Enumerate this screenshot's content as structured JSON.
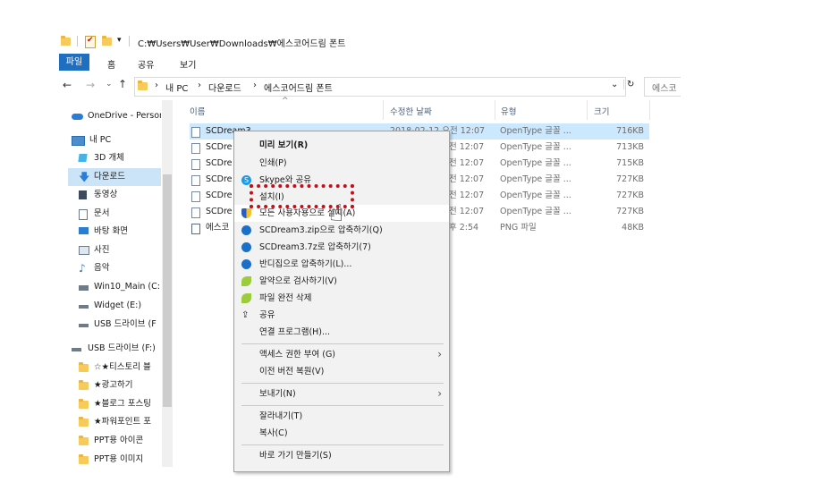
{
  "titlebar": {
    "path": "C:₩Users₩User₩Downloads₩에스코어드림 폰트"
  },
  "ribbon": {
    "tabs": [
      "파일",
      "홈",
      "공유",
      "보기"
    ]
  },
  "address": {
    "crumbs": [
      "내 PC",
      "다운로드",
      "에스코어드림 폰트"
    ],
    "search_placeholder": "에스코"
  },
  "nav": {
    "items": [
      {
        "label": "OneDrive - Personal",
        "icon": "cloud-icon"
      },
      {
        "label": "내 PC",
        "icon": "pc-icon"
      },
      {
        "label": "3D 개체",
        "icon": "cube-icon"
      },
      {
        "label": "다운로드",
        "icon": "download-arrow-icon"
      },
      {
        "label": "동영상",
        "icon": "video-icon"
      },
      {
        "label": "문서",
        "icon": "document-icon"
      },
      {
        "label": "바탕 화면",
        "icon": "desktop-icon"
      },
      {
        "label": "사진",
        "icon": "picture-icon"
      },
      {
        "label": "음악",
        "icon": "music-icon"
      },
      {
        "label": "Win10_Main (C:",
        "icon": "drive-icon"
      },
      {
        "label": "Widget (E:)",
        "icon": "drive-icon"
      },
      {
        "label": "USB 드라이브 (F",
        "icon": "usb-drive-icon"
      },
      {
        "label": "USB 드라이브 (F:)",
        "icon": "usb-drive-icon"
      },
      {
        "label": "☆★티스토리 블",
        "icon": "folder-icon"
      },
      {
        "label": "★광고하기",
        "icon": "folder-icon"
      },
      {
        "label": "★블로그 포스팅",
        "icon": "folder-icon"
      },
      {
        "label": "★파워포인트 포",
        "icon": "folder-icon"
      },
      {
        "label": "PPT용 아이콘",
        "icon": "folder-icon"
      },
      {
        "label": "PPT용 이미지",
        "icon": "folder-icon"
      }
    ]
  },
  "columns": {
    "name": "이름",
    "date": "수정한 날짜",
    "type": "유형",
    "size": "크기"
  },
  "files": [
    {
      "name": "SCDream3",
      "date": "2018-02-12 오전 12:07",
      "type": "OpenType 글꼴 ...",
      "size": "716KB"
    },
    {
      "name": "SCDre",
      "date": "전 12:07",
      "type": "OpenType 글꼴 ...",
      "size": "713KB"
    },
    {
      "name": "SCDre",
      "date": "전 12:07",
      "type": "OpenType 글꼴 ...",
      "size": "715KB"
    },
    {
      "name": "SCDre",
      "date": "전 12:07",
      "type": "OpenType 글꼴 ...",
      "size": "727KB"
    },
    {
      "name": "SCDre",
      "date": "전 12:07",
      "type": "OpenType 글꼴 ...",
      "size": "727KB"
    },
    {
      "name": "SCDre",
      "date": "전 12:07",
      "type": "OpenType 글꼴 ...",
      "size": "727KB"
    },
    {
      "name": "에스코",
      "date": "후 2:54",
      "type": "PNG 파일",
      "size": "48KB"
    }
  ],
  "context_menu": {
    "items": [
      {
        "label": "미리 보기(R)",
        "icon": "",
        "bold": true
      },
      {
        "label": "인쇄(P)",
        "icon": ""
      },
      {
        "label": "Skype와 공유",
        "icon": "skype-icon"
      },
      {
        "label": "설치(I)",
        "icon": ""
      },
      {
        "label": "모든 사용자용으로 설치(A)",
        "icon": "shield-icon"
      },
      {
        "label": "SCDream3.zip으로 압축하기(Q)",
        "icon": "bandizip-icon"
      },
      {
        "label": "SCDream3.7z로 압축하기(7)",
        "icon": "bandizip-icon"
      },
      {
        "label": "반디집으로 압축하기(L)...",
        "icon": "bandizip-icon"
      },
      {
        "label": "알약으로 검사하기(V)",
        "icon": "alyac-icon"
      },
      {
        "label": "파일 완전 삭제",
        "icon": "alyac-icon"
      },
      {
        "label": "공유",
        "icon": "share-icon"
      },
      {
        "label": "연결 프로그램(H)...",
        "icon": ""
      },
      {
        "label": "액세스 권한 부여 (G)",
        "icon": "",
        "submenu": true
      },
      {
        "label": "이전 버전 복원(V)",
        "icon": ""
      },
      {
        "label": "보내기(N)",
        "icon": "",
        "submenu": true
      },
      {
        "label": "잘라내기(T)",
        "icon": ""
      },
      {
        "label": "복사(C)",
        "icon": ""
      },
      {
        "label": "바로 가기 만들기(S)",
        "icon": ""
      }
    ]
  },
  "colors": {
    "accent": "#1e6fc2",
    "highlight_box": "#c0121a",
    "selection": "#cce8ff"
  }
}
